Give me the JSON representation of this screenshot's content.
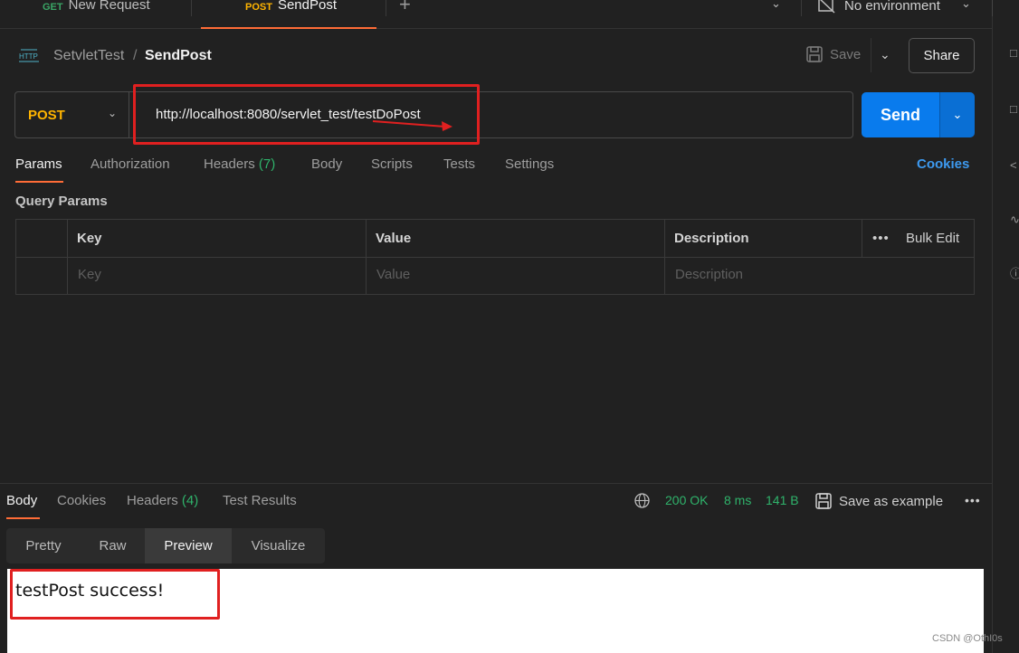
{
  "tabs": [
    {
      "method": "GET",
      "label": "New Request",
      "method_color": "#3aa565"
    },
    {
      "method": "POST",
      "label": "SendPost",
      "method_color": "#ffb400"
    }
  ],
  "environment": "No environment",
  "breadcrumb": {
    "collection": "SetvletTest",
    "separator": "/",
    "request": "SendPost"
  },
  "header_buttons": {
    "save": "Save",
    "share": "Share"
  },
  "request": {
    "method": "POST",
    "url": "http://localhost:8080/servlet_test/testDoPost",
    "send_label": "Send"
  },
  "request_tabs": [
    {
      "label": "Params"
    },
    {
      "label": "Authorization"
    },
    {
      "label": "Headers",
      "count": "(7)"
    },
    {
      "label": "Body"
    },
    {
      "label": "Scripts"
    },
    {
      "label": "Tests"
    },
    {
      "label": "Settings"
    }
  ],
  "cookies_link": "Cookies",
  "query_params": {
    "title": "Query Params",
    "columns": [
      "Key",
      "Value",
      "Description"
    ],
    "bulk_edit": "Bulk Edit",
    "placeholders": [
      "Key",
      "Value",
      "Description"
    ]
  },
  "response_tabs": [
    {
      "label": "Body"
    },
    {
      "label": "Cookies"
    },
    {
      "label": "Headers",
      "count": "(4)"
    },
    {
      "label": "Test Results"
    }
  ],
  "response_status": {
    "status": "200 OK",
    "time": "8 ms",
    "size": "141 B",
    "save_example": "Save as example"
  },
  "view_modes": [
    "Pretty",
    "Raw",
    "Preview",
    "Visualize"
  ],
  "preview_body": "testPost success!",
  "watermark": "CSDN @OthI0s",
  "colors": {
    "accent": "#ff6c37",
    "send": "#097bed",
    "post": "#ffb400",
    "ok": "#2fb36b",
    "annotation": "#e02020"
  }
}
